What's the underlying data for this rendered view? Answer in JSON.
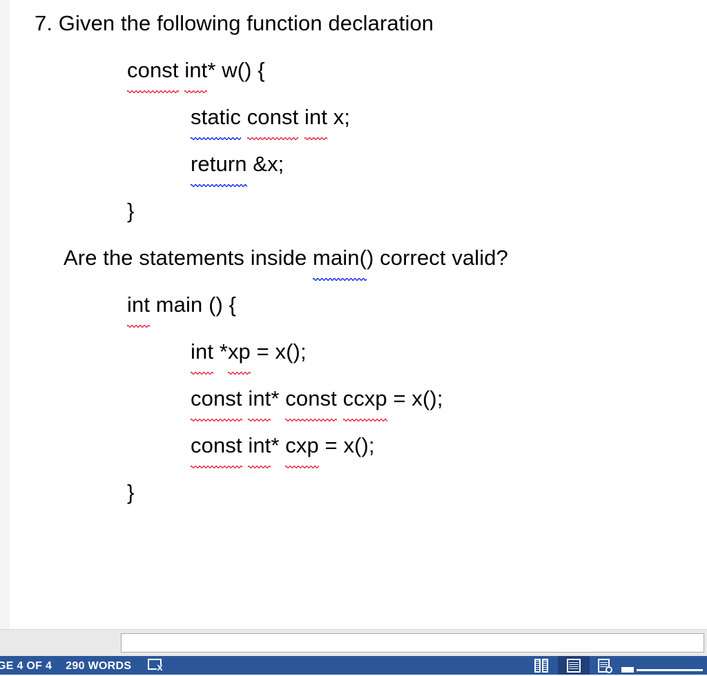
{
  "document": {
    "lines": [
      {
        "id": "question-heading",
        "indent": "ind-0",
        "segments": [
          {
            "text": "7. Given the following function declaration",
            "mark": "none"
          }
        ]
      },
      {
        "id": "code-func-signature",
        "indent": "ind-1",
        "segments": [
          {
            "text": "const",
            "mark": "red"
          },
          {
            "text": " ",
            "mark": "none"
          },
          {
            "text": "int",
            "mark": "red"
          },
          {
            "text": "* w() {",
            "mark": "none"
          }
        ]
      },
      {
        "id": "code-static-const-int-x",
        "indent": "ind-2",
        "segments": [
          {
            "text": "static",
            "mark": "blue"
          },
          {
            "text": " ",
            "mark": "none"
          },
          {
            "text": "const",
            "mark": "red"
          },
          {
            "text": " ",
            "mark": "none"
          },
          {
            "text": "int",
            "mark": "red"
          },
          {
            "text": " x;",
            "mark": "none"
          }
        ]
      },
      {
        "id": "code-return-address-x",
        "indent": "ind-2",
        "segments": [
          {
            "text": "return",
            "mark": "blue"
          },
          {
            "text": " &x;",
            "mark": "none"
          }
        ]
      },
      {
        "id": "code-close-brace-w",
        "indent": "ind-1",
        "segments": [
          {
            "text": "}",
            "mark": "none"
          }
        ]
      },
      {
        "id": "question-prompt",
        "indent": "ind-q",
        "segments": [
          {
            "text": "Are the statements inside ",
            "mark": "none"
          },
          {
            "text": "main(",
            "mark": "blue"
          },
          {
            "text": ") correct valid?",
            "mark": "none"
          }
        ]
      },
      {
        "id": "code-main-signature",
        "indent": "ind-1",
        "segments": [
          {
            "text": "int",
            "mark": "red"
          },
          {
            "text": " main () {",
            "mark": "none"
          }
        ]
      },
      {
        "id": "code-int-xp",
        "indent": "ind-2",
        "segments": [
          {
            "text": "int",
            "mark": "red"
          },
          {
            "text": " *",
            "mark": "none"
          },
          {
            "text": "xp",
            "mark": "red"
          },
          {
            "text": " = x();",
            "mark": "none"
          }
        ]
      },
      {
        "id": "code-const-int-const-ccxp",
        "indent": "ind-2",
        "segments": [
          {
            "text": "const",
            "mark": "red"
          },
          {
            "text": " ",
            "mark": "none"
          },
          {
            "text": "int",
            "mark": "red"
          },
          {
            "text": "* ",
            "mark": "none"
          },
          {
            "text": "const",
            "mark": "red"
          },
          {
            "text": " ",
            "mark": "none"
          },
          {
            "text": "ccxp",
            "mark": "red"
          },
          {
            "text": " = x();",
            "mark": "none"
          }
        ]
      },
      {
        "id": "code-const-int-cxp",
        "indent": "ind-2",
        "segments": [
          {
            "text": "const",
            "mark": "red"
          },
          {
            "text": " ",
            "mark": "none"
          },
          {
            "text": "int",
            "mark": "red"
          },
          {
            "text": "* ",
            "mark": "none"
          },
          {
            "text": "cxp",
            "mark": "red"
          },
          {
            "text": " = x();",
            "mark": "none"
          }
        ]
      },
      {
        "id": "code-close-brace-main",
        "indent": "ind-1",
        "segments": [
          {
            "text": "}",
            "mark": "none"
          }
        ]
      }
    ]
  },
  "statusbar": {
    "page_count_label": "GE 4 OF 4",
    "word_count_label": "290 WORDS",
    "proofing_icon": "proofing-errors-icon",
    "views": [
      {
        "name": "read-mode",
        "label": "Read Mode",
        "selected": false
      },
      {
        "name": "print-layout",
        "label": "Print Layout",
        "selected": true
      },
      {
        "name": "web-layout",
        "label": "Web Layout",
        "selected": false
      }
    ],
    "zoom": {
      "name": "zoom-slider"
    },
    "accent_color": "#2b579a"
  },
  "scrollbar": {
    "orientation": "horizontal",
    "name": "horizontal-scrollbar"
  },
  "spellcheck": {
    "spelling_color": "#e8374a",
    "grammar_color": "#2038f0"
  }
}
